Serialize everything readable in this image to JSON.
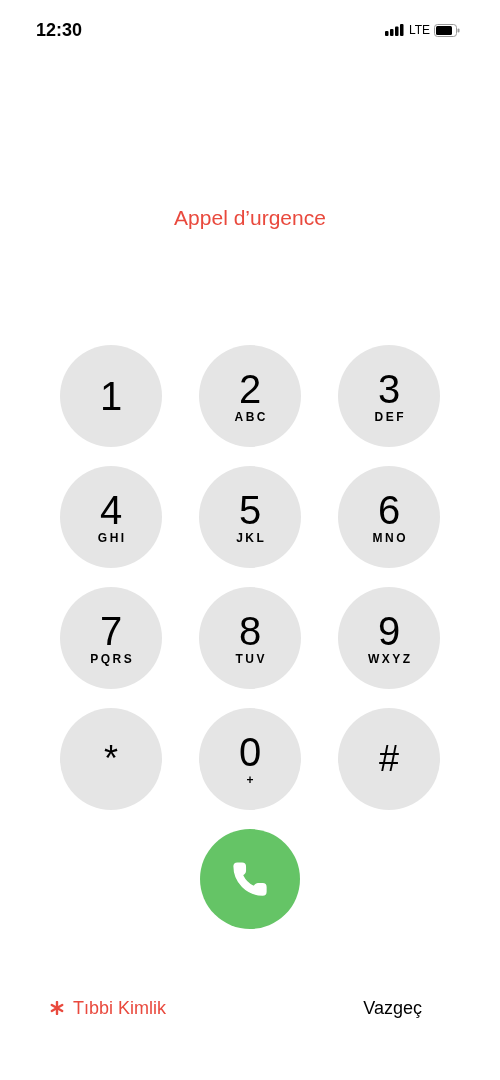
{
  "status_bar": {
    "time": "12:30",
    "network": "LTE"
  },
  "title": "Appel d’urgence",
  "keys": [
    {
      "digit": "1"
    },
    {
      "digit": "2",
      "letters": "ABC"
    },
    {
      "digit": "3",
      "letters": "DEF"
    },
    {
      "digit": "4",
      "letters": "GHI"
    },
    {
      "digit": "5",
      "letters": "JKL"
    },
    {
      "digit": "6",
      "letters": "MNO"
    },
    {
      "digit": "7",
      "letters": "PQRS"
    },
    {
      "digit": "8",
      "letters": "TUV"
    },
    {
      "digit": "9",
      "letters": "WXYZ"
    },
    {
      "digit": "*"
    },
    {
      "digit": "0",
      "letters": "+"
    },
    {
      "digit": "#"
    }
  ],
  "bottom": {
    "medical_id": "Tıbbi Kimlik",
    "cancel": "Vazgeç"
  }
}
